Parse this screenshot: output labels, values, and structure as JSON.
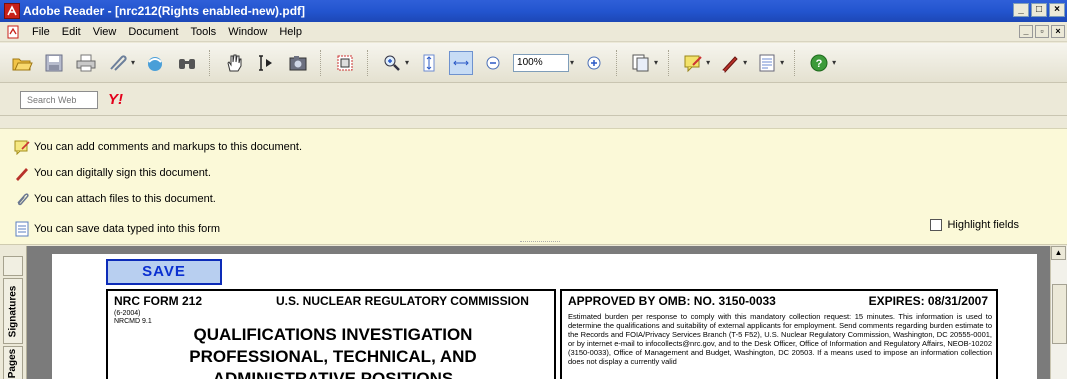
{
  "window": {
    "title": "Adobe Reader - [nrc212(Rights enabled-new).pdf]",
    "minimize": "_",
    "maximize": "□",
    "close": "×",
    "doc_minimize": "_",
    "doc_restore": "▫",
    "doc_close": "×"
  },
  "menu": {
    "items": [
      "File",
      "Edit",
      "View",
      "Document",
      "Tools",
      "Window",
      "Help"
    ]
  },
  "toolbar": {
    "zoom_value": "100%",
    "icons": [
      "open-icon",
      "save-icon",
      "print-icon",
      "email-icon",
      "organize-icon",
      "search-icon",
      "hand-tool-icon",
      "select-text-icon",
      "snapshot-icon",
      "crop-icon",
      "zoom-in-icon",
      "fit-page-icon",
      "fit-width-icon",
      "zoom-out-icon",
      "zoom-in-plus-icon",
      "pages-icon",
      "comment-icon",
      "sign-icon",
      "forms-icon",
      "help-icon"
    ]
  },
  "search": {
    "placeholder": "Search Web",
    "brand": "Y!"
  },
  "messages": [
    "You can add comments and markups to this document.",
    "You can digitally sign this document.",
    "You can attach files to this document.",
    "You can save data typed into this form"
  ],
  "highlight_fields_label": "Highlight fields",
  "side_tabs": [
    "Signatures",
    "Pages"
  ],
  "form": {
    "save_label": "SAVE",
    "form_number": "NRC FORM 212",
    "date_code": "(6-2004)",
    "nrcmd": "NRCMD 9.1",
    "agency": "U.S. NUCLEAR REGULATORY COMMISSION",
    "title_line1": "QUALIFICATIONS INVESTIGATION",
    "title_line2": "PROFESSIONAL, TECHNICAL, AND",
    "title_line3": "ADMINISTRATIVE POSITIONS",
    "omb": "APPROVED BY OMB: NO. 3150-0033",
    "expires": "EXPIRES: 08/31/2007",
    "burden_text": "Estimated burden per response to comply with this mandatory collection request: 15 minutes. This information is used to determine the qualifications and suitability of external applicants for employment. Send comments regarding burden estimate to the Records and FOIA/Privacy Services Branch (T-5 F52), U.S. Nuclear Regulatory Commission, Washington, DC 20555-0001, or by internet e-mail to infocollects@nrc.gov, and to the Desk Officer, Office of Information and Regulatory Affairs, NEOB-10202 (3150-0033), Office of Management and Budget, Washington, DC 20503. If a means used to impose an information collection does not display a currently valid"
  }
}
